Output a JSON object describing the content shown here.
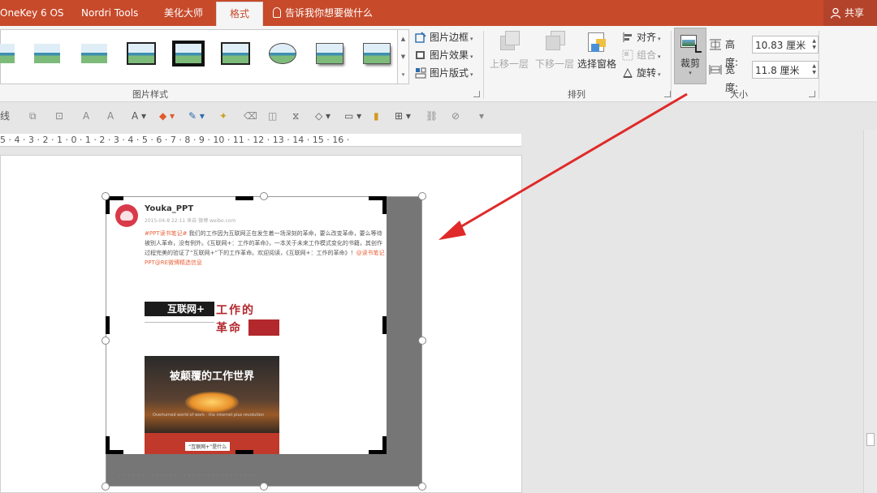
{
  "tabs": [
    {
      "label": "OneKey 6 OS",
      "active": false
    },
    {
      "label": "Nordri Tools",
      "active": false
    },
    {
      "label": "美化大师",
      "active": false
    },
    {
      "label": "格式",
      "active": true
    }
  ],
  "tell_me": "告诉我你想要做什么",
  "share": "共享",
  "ribbon": {
    "picture_styles": {
      "label": "图片样式",
      "border": "图片边框",
      "effects": "图片效果",
      "layout": "图片版式"
    },
    "arrange": {
      "label": "排列",
      "bring_forward": "上移一层",
      "send_backward": "下移一层",
      "selection_pane": "选择窗格",
      "align": "对齐",
      "group": "组合",
      "rotate": "旋转"
    },
    "size": {
      "label": "大小",
      "crop": "裁剪",
      "height_label": "高度:",
      "height_value": "10.83 厘米",
      "width_label": "宽度:",
      "width_value": "11.8 厘米"
    }
  },
  "quick_toolbar": {
    "first_label": "线"
  },
  "ruler": "5 · 4 · 3 · 2 · 1 · 0 · 1 · 2 · 3 · 4 · 5 · 6 · 7 · 8 · 9 · 10 · 11 · 12 · 13 · 14 · 15 · 16 ·",
  "image": {
    "username": "Youka_PPT",
    "meta": "2015-04-8 22:11 来自 微博 weibo.com",
    "body_highlight": "#PPT读书笔记#",
    "body_text": " 我们的工作因为互联网正在发生着一场深刻的革命，要么改变革命，要么等待被别人革命，没有例外。《互联网+：工作的革命》，一本关于未来工作模式变化的书籍，其创作过程完美的验证了“互联网+”下的工作革命。欢迎阅读，《互联网+：工作的革命》！",
    "body_link": "@读书笔记PPT@RE微博精选信息",
    "book1_black": "互联网+",
    "book1_red_top": "工作的",
    "book1_red_bottom": "革命",
    "book2_title": "被颠覆的工作世界",
    "book2_sub": "Overturned world of work · the internet plus revolution",
    "book2_tag": "“互联网+”是什么"
  },
  "colors": {
    "tabbar": "#c74a2b",
    "accent_arrow": "#e02a2a",
    "ribbon": "#f5f5f5"
  }
}
